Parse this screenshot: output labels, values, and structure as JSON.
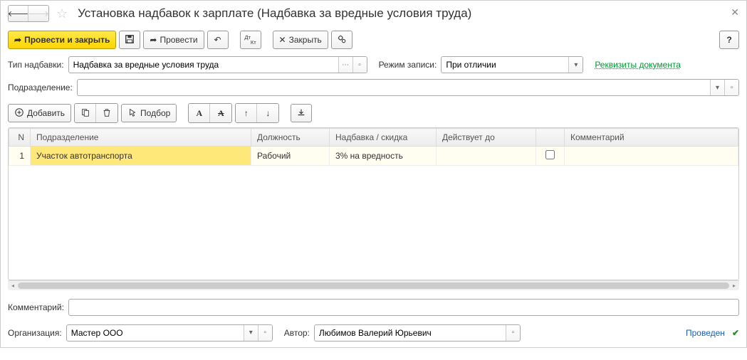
{
  "title": "Установка надбавок к зарплате (Надбавка за вредные условия труда)",
  "toolbar": {
    "post_close": "Провести и закрыть",
    "post": "Провести",
    "close": "Закрыть"
  },
  "form": {
    "type_label": "Тип надбавки:",
    "type_value": "Надбавка за вредные условия труда",
    "mode_label": "Режим записи:",
    "mode_value": "При отличии",
    "details_link": "Реквизиты документа",
    "division_label": "Подразделение:",
    "division_value": ""
  },
  "table_toolbar": {
    "add": "Добавить",
    "select": "Подбор"
  },
  "grid": {
    "headers": {
      "n": "N",
      "division": "Подразделение",
      "position": "Должность",
      "allowance": "Надбавка / скидка",
      "valid_until": "Действует до",
      "checkbox": "",
      "comment": "Комментарий"
    },
    "rows": [
      {
        "n": "1",
        "division": "Участок автотранспорта",
        "position": "Рабочий",
        "allowance": "3% на вредность",
        "valid_until": "",
        "checked": false,
        "comment": ""
      }
    ]
  },
  "footer": {
    "comment_label": "Комментарий:",
    "comment_value": "",
    "org_label": "Организация:",
    "org_value": "Мастер ООО",
    "author_label": "Автор:",
    "author_value": "Любимов Валерий Юрьевич",
    "status": "Проведен"
  }
}
